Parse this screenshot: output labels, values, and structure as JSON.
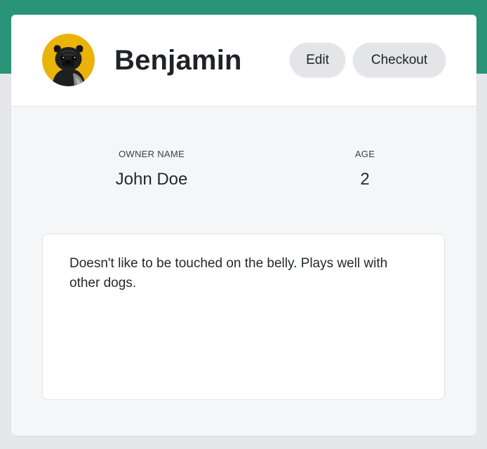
{
  "theme": {
    "accent": "#2a9476",
    "page_background": "#e5e7eb",
    "card_background": "#f5f6f8",
    "avatar_background": "#eab308"
  },
  "pet": {
    "name": "Benjamin",
    "avatar_icon": "pug-dog-photo"
  },
  "actions": {
    "edit_label": "Edit",
    "checkout_label": "Checkout"
  },
  "details": {
    "owner_label": "OWNER NAME",
    "owner_value": "John Doe",
    "age_label": "AGE",
    "age_value": "2"
  },
  "notes": {
    "text": "Doesn't like to be touched on the belly. Plays well with other dogs."
  }
}
